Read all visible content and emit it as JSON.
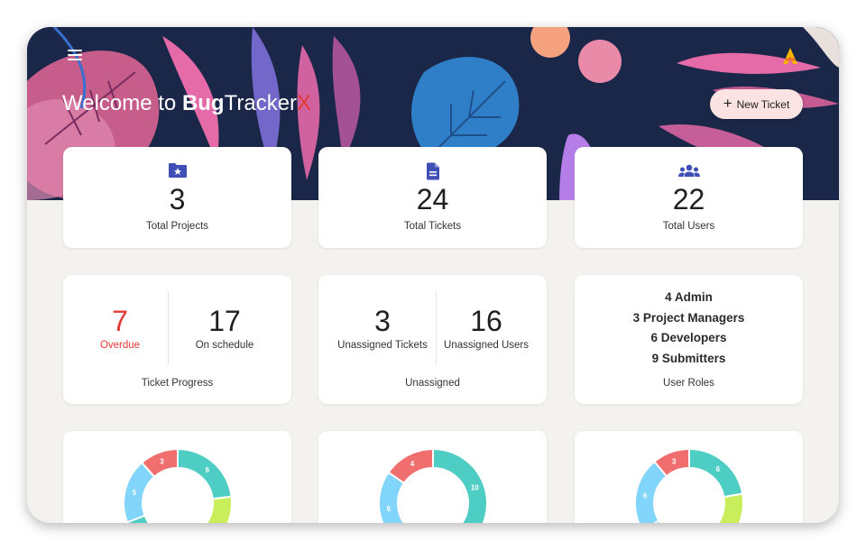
{
  "app": {
    "title_prefix": "Welcome to ",
    "brand_bold": "Bug",
    "brand_mid": "Tracker",
    "brand_x": "X"
  },
  "header": {
    "new_ticket_label": "New Ticket"
  },
  "icons": {
    "menu": "menu-icon",
    "logo": "logo-icon",
    "plus": "plus-icon",
    "folder": "folder-star-icon",
    "file": "document-icon",
    "users": "users-group-icon"
  },
  "colors": {
    "accent_red": "#e53935",
    "icon_blue": "#3f4fb6",
    "teal": "#4ecdc4",
    "lime": "#c8ef5b",
    "sky": "#81d4fa",
    "coral": "#f06e6e"
  },
  "stats": [
    {
      "value": "3",
      "label": "Total Projects"
    },
    {
      "value": "24",
      "label": "Total Tickets"
    },
    {
      "value": "22",
      "label": "Total Users"
    }
  ],
  "progress": {
    "overdue_value": "7",
    "overdue_label": "Overdue",
    "schedule_value": "17",
    "schedule_label": "On schedule",
    "footer": "Ticket Progress"
  },
  "unassigned": {
    "tickets_value": "3",
    "tickets_label": "Unassigned Tickets",
    "users_value": "16",
    "users_label": "Unassigned Users",
    "footer": "Unassigned"
  },
  "roles": {
    "lines": [
      "4 Admin",
      "3 Project Managers",
      "6 Developers",
      "9 Submitters"
    ],
    "footer": "User Roles"
  },
  "chart_data": [
    {
      "type": "pie",
      "labels": [
        "3",
        "6",
        "5"
      ],
      "values": [
        3,
        6,
        5
      ],
      "colors": [
        "#f06e6e",
        "#4ecdc4",
        "#81d4fa"
      ],
      "partial_colors_visible": [
        "#c8ef5b"
      ]
    },
    {
      "type": "pie",
      "labels": [
        "4",
        "10",
        "6"
      ],
      "values": [
        4,
        10,
        6
      ],
      "colors": [
        "#f06e6e",
        "#4ecdc4",
        "#81d4fa"
      ]
    },
    {
      "type": "pie",
      "labels": [
        "3",
        "6",
        "6"
      ],
      "values": [
        3,
        6,
        6
      ],
      "colors": [
        "#f06e6e",
        "#4ecdc4",
        "#81d4fa"
      ],
      "partial_colors_visible": [
        "#c8ef5b"
      ]
    }
  ]
}
